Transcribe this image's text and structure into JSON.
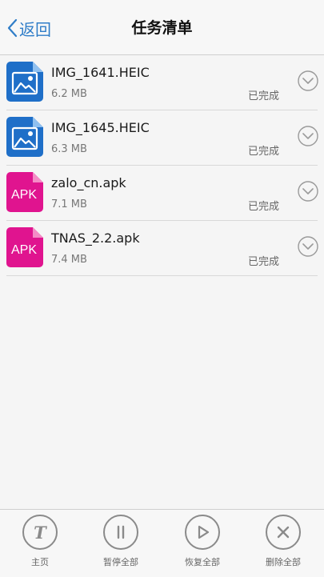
{
  "header": {
    "back_label": "返回",
    "title": "任务清单"
  },
  "tasks": [
    {
      "name": "IMG_1641.HEIC",
      "size": "6.2 MB",
      "status": "已完成",
      "type": "image",
      "icon": "image-file-icon"
    },
    {
      "name": "IMG_1645.HEIC",
      "size": "6.3 MB",
      "status": "已完成",
      "type": "image",
      "icon": "image-file-icon"
    },
    {
      "name": "zalo_cn.apk",
      "size": "7.1 MB",
      "status": "已完成",
      "type": "apk",
      "icon": "apk-file-icon",
      "icon_text": "APK"
    },
    {
      "name": "TNAS_2.2.apk",
      "size": "7.4 MB",
      "status": "已完成",
      "type": "apk",
      "icon": "apk-file-icon",
      "icon_text": "APK"
    }
  ],
  "toolbar": {
    "home_label": "主页",
    "home_icon_text": "T",
    "pause_all_label": "暂停全部",
    "resume_all_label": "恢复全部",
    "delete_all_label": "删除全部"
  },
  "colors": {
    "accent": "#2f7dc8",
    "image_icon": "#1f6fc8",
    "apk_icon": "#e0148f",
    "toolbar_icon": "#8a8a8a"
  }
}
